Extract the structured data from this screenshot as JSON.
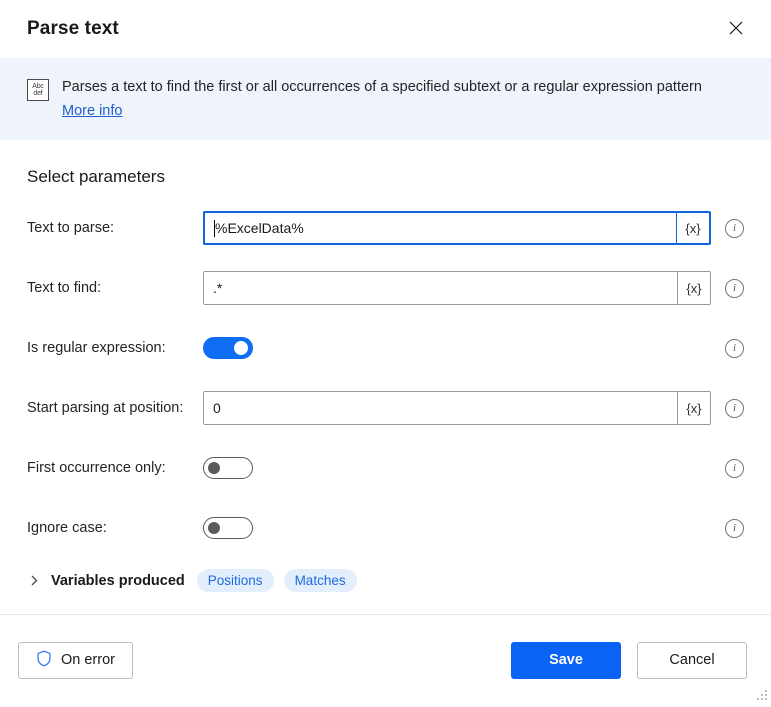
{
  "dialog": {
    "title": "Parse text",
    "close_icon": "close-icon"
  },
  "banner": {
    "icon": "abc-def-text-icon",
    "icon_line1": "Abc",
    "icon_line2": "def",
    "description": "Parses a text to find the first or all occurrences of a specified subtext or a regular expression pattern",
    "more_info_label": "More info"
  },
  "parameters": {
    "section_title": "Select parameters",
    "fields": [
      {
        "label": "Text to parse:",
        "type": "text",
        "value": "%ExcelData%",
        "placeholder": "",
        "focused": true,
        "variable_button": "{x}",
        "info_icon": "info-icon"
      },
      {
        "label": "Text to find:",
        "type": "text",
        "value": ".*",
        "placeholder": "",
        "focused": false,
        "variable_button": "{x}",
        "info_icon": "info-icon"
      },
      {
        "label": "Is regular expression:",
        "type": "toggle",
        "state": "on",
        "info_icon": "info-icon"
      },
      {
        "label": "Start parsing at position:",
        "type": "text",
        "value": "0",
        "placeholder": "",
        "focused": false,
        "variable_button": "{x}",
        "info_icon": "info-icon"
      },
      {
        "label": "First occurrence only:",
        "type": "toggle",
        "state": "off",
        "info_icon": "info-icon"
      },
      {
        "label": "Ignore case:",
        "type": "toggle",
        "state": "off",
        "info_icon": "info-icon"
      }
    ]
  },
  "variables_produced": {
    "chevron": "chevron-right-icon",
    "label": "Variables produced",
    "pills": [
      "Positions",
      "Matches"
    ]
  },
  "footer": {
    "on_error_label": "On error",
    "on_error_icon": "shield-icon",
    "save_label": "Save",
    "cancel_label": "Cancel",
    "resize_grip": "resize-grip-icon"
  },
  "colors": {
    "accent": "#0b63f6",
    "toggle_on": "#0f6cf4",
    "banner_bg": "#eff4fc",
    "link": "#1f5fcc",
    "pill_bg": "#e3eefc",
    "pill_text": "#1f6ae0",
    "focus_border": "#1264d8"
  }
}
